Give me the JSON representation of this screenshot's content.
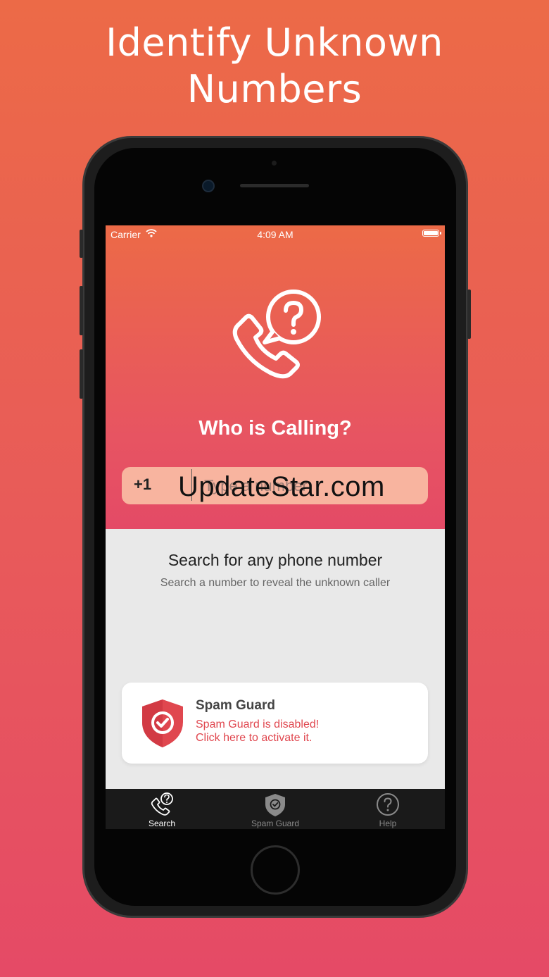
{
  "headline": {
    "line1": "Identify Unknown",
    "line2": "Numbers"
  },
  "status_bar": {
    "carrier": "Carrier",
    "time": "4:09 AM"
  },
  "hero": {
    "title": "Who is Calling?",
    "country_code": "+1",
    "input_placeholder": "Type a number",
    "watermark": "UpdateStar.com"
  },
  "info": {
    "title": "Search for any phone number",
    "subtitle": "Search a number to reveal the unknown caller"
  },
  "spam_card": {
    "title": "Spam Guard",
    "line1": "Spam Guard is disabled!",
    "line2": "Click here to activate it."
  },
  "tabs": [
    {
      "label": "Search",
      "icon": "phone-question-icon",
      "active": true
    },
    {
      "label": "Spam Guard",
      "icon": "shield-check-icon",
      "active": false
    },
    {
      "label": "Help",
      "icon": "question-circle-icon",
      "active": false
    }
  ],
  "colors": {
    "accent": "#e85a5a",
    "warning_text": "#e0474f",
    "tab_active": "#ffffff",
    "tab_inactive": "#8a8a8a"
  }
}
